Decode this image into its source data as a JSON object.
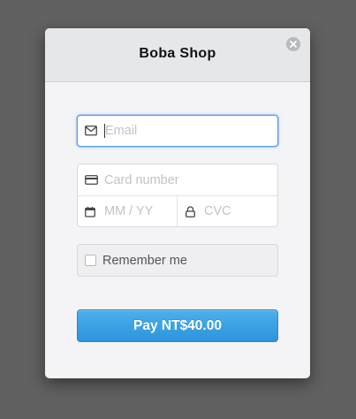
{
  "header": {
    "title": "Boba Shop"
  },
  "form": {
    "email_placeholder": "Email",
    "card_number_placeholder": "Card number",
    "expiry_placeholder": "MM / YY",
    "cvc_placeholder": "CVC",
    "remember_label": "Remember me",
    "remember_checked": false,
    "pay_label": "Pay NT$40.00"
  },
  "icons": {
    "close": "close-icon",
    "email": "envelope-icon",
    "card": "credit-card-icon",
    "expiry": "calendar-icon",
    "cvc": "lock-icon"
  },
  "colors": {
    "accent": "#2d94dc",
    "focus": "#5b9ce6"
  }
}
